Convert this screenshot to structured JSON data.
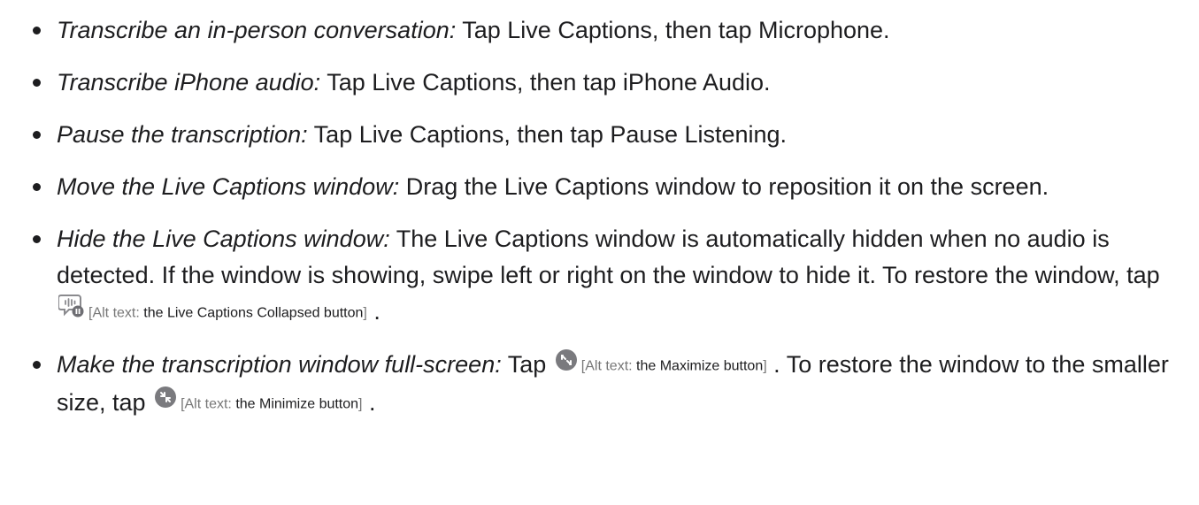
{
  "items": [
    {
      "lead": "Transcribe an in-person conversation:",
      "text": " Tap Live Captions, then tap Microphone."
    },
    {
      "lead": "Transcribe iPhone audio:",
      "text": " Tap Live Captions, then tap iPhone Audio."
    },
    {
      "lead": "Pause the transcription:",
      "text": " Tap Live Captions, then tap Pause Listening."
    },
    {
      "lead": "Move the Live Captions window:",
      "text": " Drag the Live Captions window to reposition it on the screen."
    },
    {
      "lead": "Hide the Live Captions window:",
      "text": " The Live Captions window is automatically hidden when no audio is detected. If the window is showing, swipe left or right on the window to hide it. To restore the window, tap ",
      "icon": "live-captions-collapsed-icon",
      "alt_prefix": "[Alt text: ",
      "alt_desc": "the Live Captions Collapsed button",
      "alt_suffix": "]",
      "end": " ."
    },
    {
      "lead": "Make the transcription window full-screen:",
      "text": " Tap ",
      "icon": "maximize-icon",
      "alt_prefix": "[Alt text: ",
      "alt_desc": "the Maximize button",
      "alt_suffix": "]",
      "mid": " . To restore the window to the smaller size, tap ",
      "icon2": "minimize-icon",
      "alt2_prefix": "[Alt text: ",
      "alt2_desc": "the Minimize button",
      "alt2_suffix": "]",
      "end": " ."
    }
  ]
}
